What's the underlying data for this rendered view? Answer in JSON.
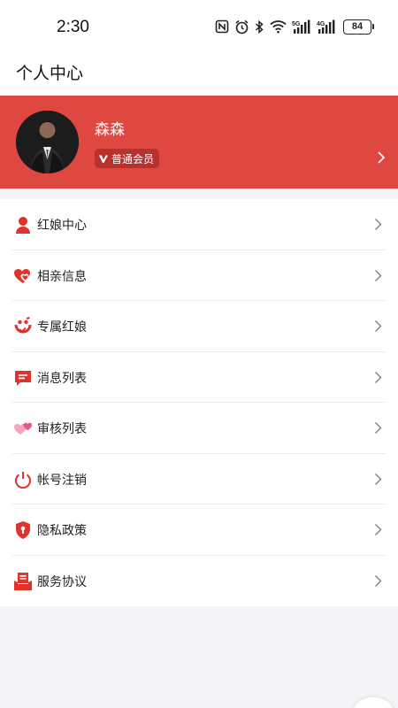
{
  "status_bar": {
    "time": "2:30",
    "battery": "84",
    "icons": [
      "nfc-icon",
      "alarm-icon",
      "bluetooth-icon",
      "wifi-icon",
      "signal-5g-icon",
      "signal-4g-icon",
      "battery-icon"
    ]
  },
  "header": {
    "title": "个人中心"
  },
  "profile": {
    "name": "森森",
    "badge": "普通会员",
    "background_color": "#df4741"
  },
  "menu": [
    {
      "label": "红娘中心",
      "icon": "person-icon"
    },
    {
      "label": "相亲信息",
      "icon": "hearts-icon"
    },
    {
      "label": "专属红娘",
      "icon": "matchmaker-icon"
    },
    {
      "label": "消息列表",
      "icon": "message-icon"
    },
    {
      "label": "审核列表",
      "icon": "review-hearts-icon"
    },
    {
      "label": "帐号注销",
      "icon": "power-icon"
    },
    {
      "label": "隐私政策",
      "icon": "shield-icon"
    },
    {
      "label": "服务协议",
      "icon": "agreement-icon"
    }
  ],
  "colors": {
    "accent": "#df4741",
    "icon_red": "#e0332d"
  }
}
